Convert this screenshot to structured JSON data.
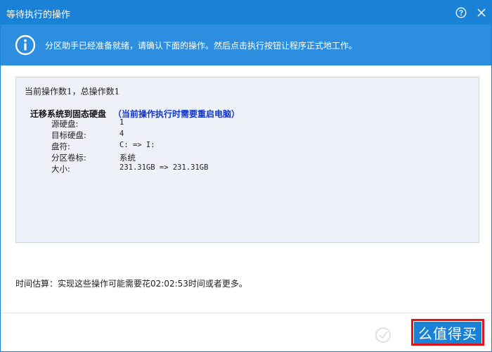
{
  "window": {
    "title": "等待执行的操作"
  },
  "titlebar": {
    "help_icon": "help-circle-icon",
    "close_icon": "close-icon"
  },
  "banner": {
    "icon": "info-icon",
    "text": "分区助手已经准备就绪，请确认下面的操作。然后点击执行按钮让程序正式地工作。"
  },
  "operations": {
    "summary": "当前操作数1，总操作数1",
    "items": [
      {
        "title": "迁移系统到固态硬盘",
        "note": "（当前操作执行时需要重启电脑）",
        "details": [
          {
            "label": "源硬盘:",
            "value": "1"
          },
          {
            "label": "目标硬盘:",
            "value": "4"
          },
          {
            "label": "盘符:",
            "value": "C: => I:"
          },
          {
            "label": "分区卷标:",
            "value": "系统"
          },
          {
            "label": "大小:",
            "value": "231.31GB => 231.31GB"
          }
        ]
      }
    ]
  },
  "estimate": "时间估算：实现这些操作可能需要花02:02:53时间或者更多。",
  "footer": {
    "ok_label": "么值得买"
  },
  "colors": {
    "titlebar": "#1a82d6",
    "banner": "#2d8ee0",
    "note": "#1336c6",
    "highlight": "#e2141a"
  }
}
